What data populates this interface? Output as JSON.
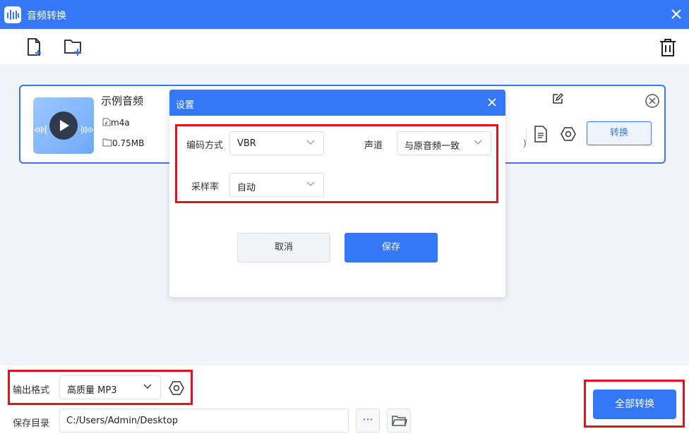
{
  "app": {
    "title": "音频转换"
  },
  "file": {
    "name": "示例音频",
    "format": "m4a",
    "size": "0.75MB",
    "convert_label": "转换",
    "partial_text": ")"
  },
  "dialog": {
    "title": "设置",
    "encoding": {
      "label": "编码方式",
      "value": "VBR"
    },
    "channel": {
      "label": "声道",
      "value": "与原音频一致"
    },
    "sample_rate": {
      "label": "采样率",
      "value": "自动"
    },
    "cancel_label": "取消",
    "save_label": "保存"
  },
  "bottom": {
    "output_format_label": "输出格式",
    "output_format_value": "高质量 MP3",
    "save_dir_label": "保存目录",
    "save_dir_value": "C:/Users/Admin/Desktop",
    "more_label": "···",
    "convert_all_label": "全部转换"
  },
  "colors": {
    "accent": "#3478f6",
    "highlight": "#e0141c"
  }
}
